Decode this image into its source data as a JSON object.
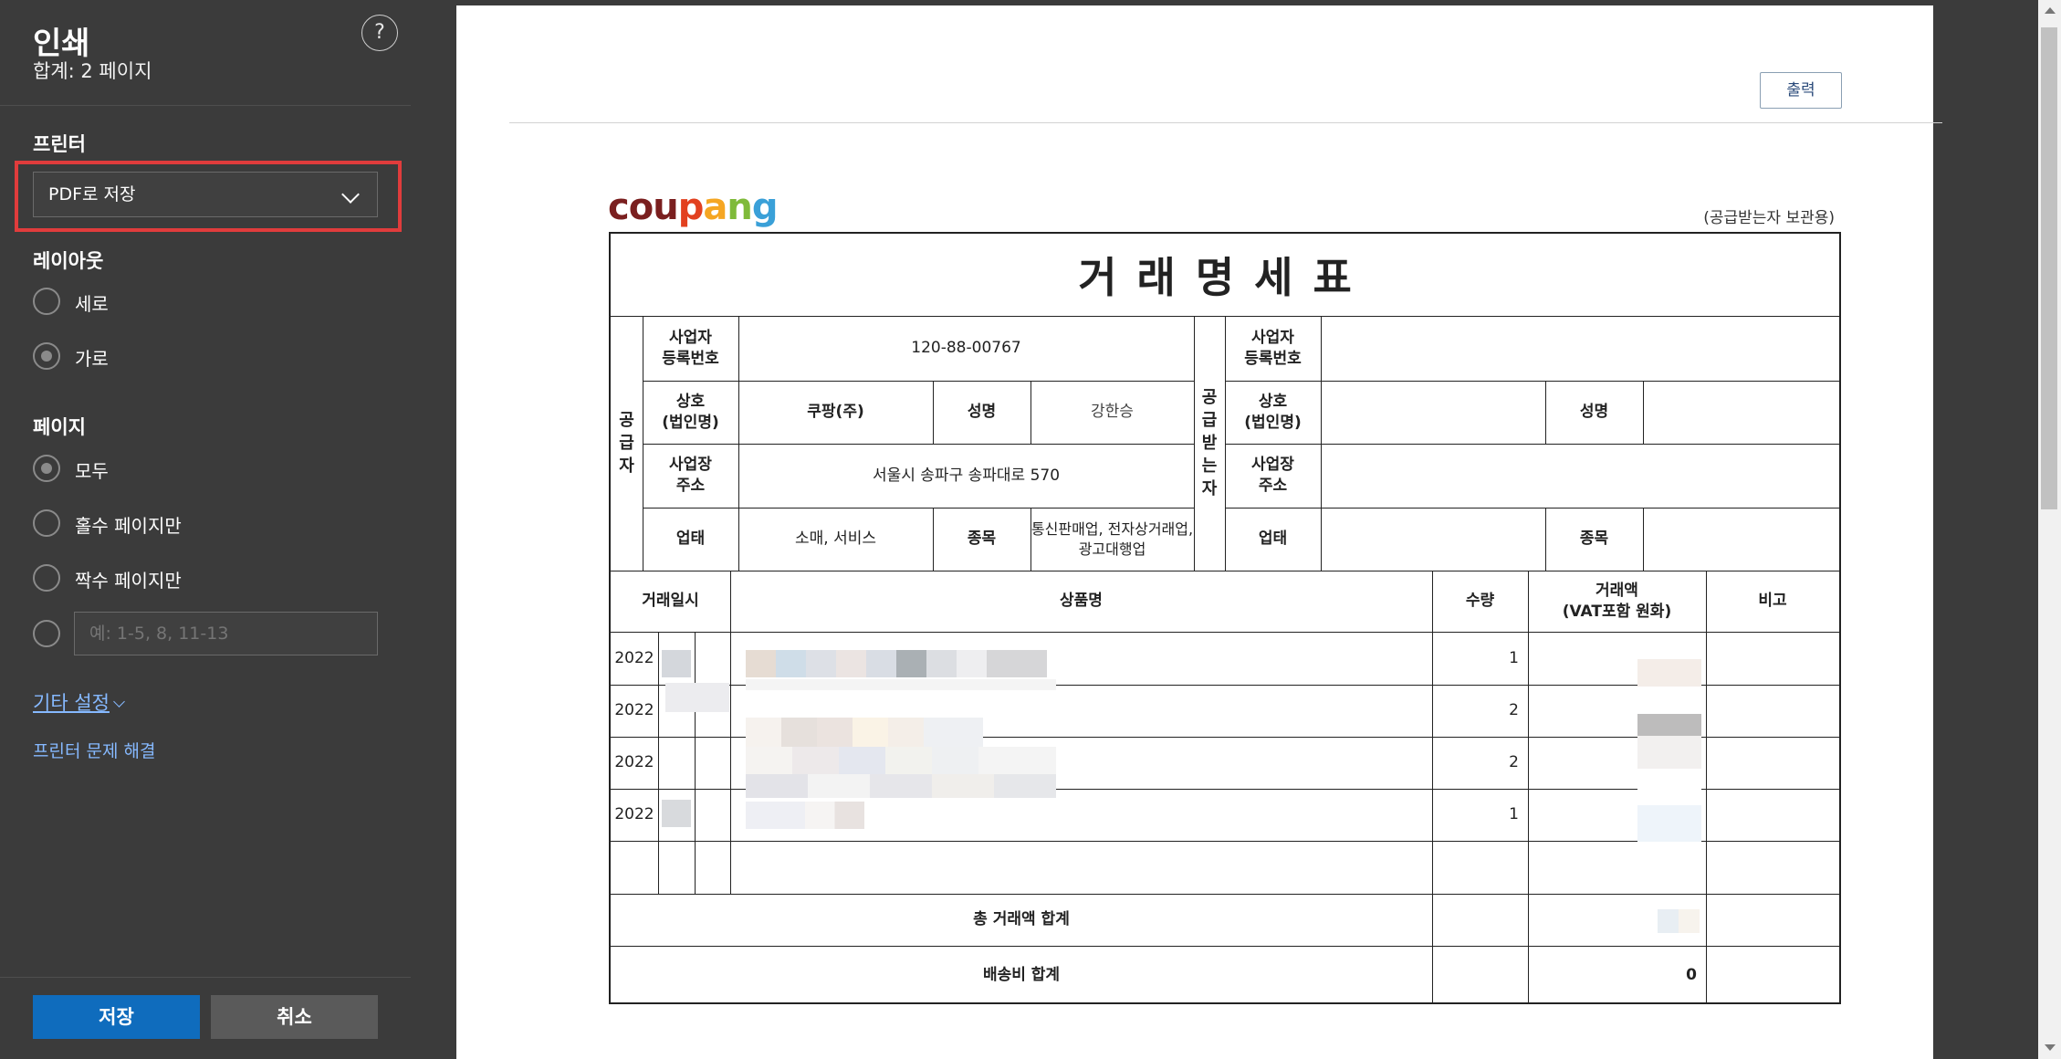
{
  "sidebar": {
    "title": "인쇄",
    "subtitle": "합계: 2 페이지",
    "help_glyph": "?",
    "printer_label": "프린터",
    "printer_value": "PDF로 저장",
    "layout_label": "레이아웃",
    "layout_options": [
      {
        "label": "세로",
        "checked": false
      },
      {
        "label": "가로",
        "checked": true
      }
    ],
    "pages_label": "페이지",
    "pages_options": [
      {
        "label": "모두",
        "checked": true
      },
      {
        "label": "홀수 페이지만",
        "checked": false
      },
      {
        "label": "짝수 페이지만",
        "checked": false
      }
    ],
    "range_placeholder": "예: 1-5, 8, 11-13",
    "more_settings": "기타 설정",
    "troubleshoot": "프린터 문제 해결",
    "save_button": "저장",
    "cancel_button": "취소"
  },
  "preview": {
    "print_button": "출력",
    "logo_letters": [
      {
        "ch": "c",
        "color": "#7a1f1f"
      },
      {
        "ch": "o",
        "color": "#7a1f1f"
      },
      {
        "ch": "u",
        "color": "#7a1f1f"
      },
      {
        "ch": "p",
        "color": "#e2401f"
      },
      {
        "ch": "a",
        "color": "#f5a623"
      },
      {
        "ch": "n",
        "color": "#7fba3a"
      },
      {
        "ch": "g",
        "color": "#3aa0d8"
      }
    ],
    "copy_note": "(공급받는자 보관용)",
    "doc_title": "거래명세표",
    "supplier_side": "공급자",
    "receiver_side": "공급받는자",
    "labels": {
      "reg_no": "사업자\n등록번호",
      "company": "상호\n(법인명)",
      "name": "성명",
      "address": "사업장\n주소",
      "biz_type": "업태",
      "biz_item": "종목"
    },
    "supplier": {
      "reg_no": "120-88-00767",
      "company": "쿠팡(주)",
      "name": "강한승",
      "address": "서울시 송파구 송파대로 570",
      "biz_type": "소매, 서비스",
      "biz_item": "통신판매업, 전자상거래업,\n광고대행업"
    },
    "table_headers": {
      "date": "거래일시",
      "product": "상품명",
      "qty": "수량",
      "amount": "거래액\n(VAT포함 원화)",
      "note": "비고"
    },
    "rows": [
      {
        "date": "2022",
        "qty": "1"
      },
      {
        "date": "2022",
        "qty": "2"
      },
      {
        "date": "2022",
        "qty": "2"
      },
      {
        "date": "2022",
        "qty": "1"
      }
    ],
    "total_label": "총 거래액 합계",
    "shipping_label": "배송비 합계",
    "shipping_value": "0"
  }
}
